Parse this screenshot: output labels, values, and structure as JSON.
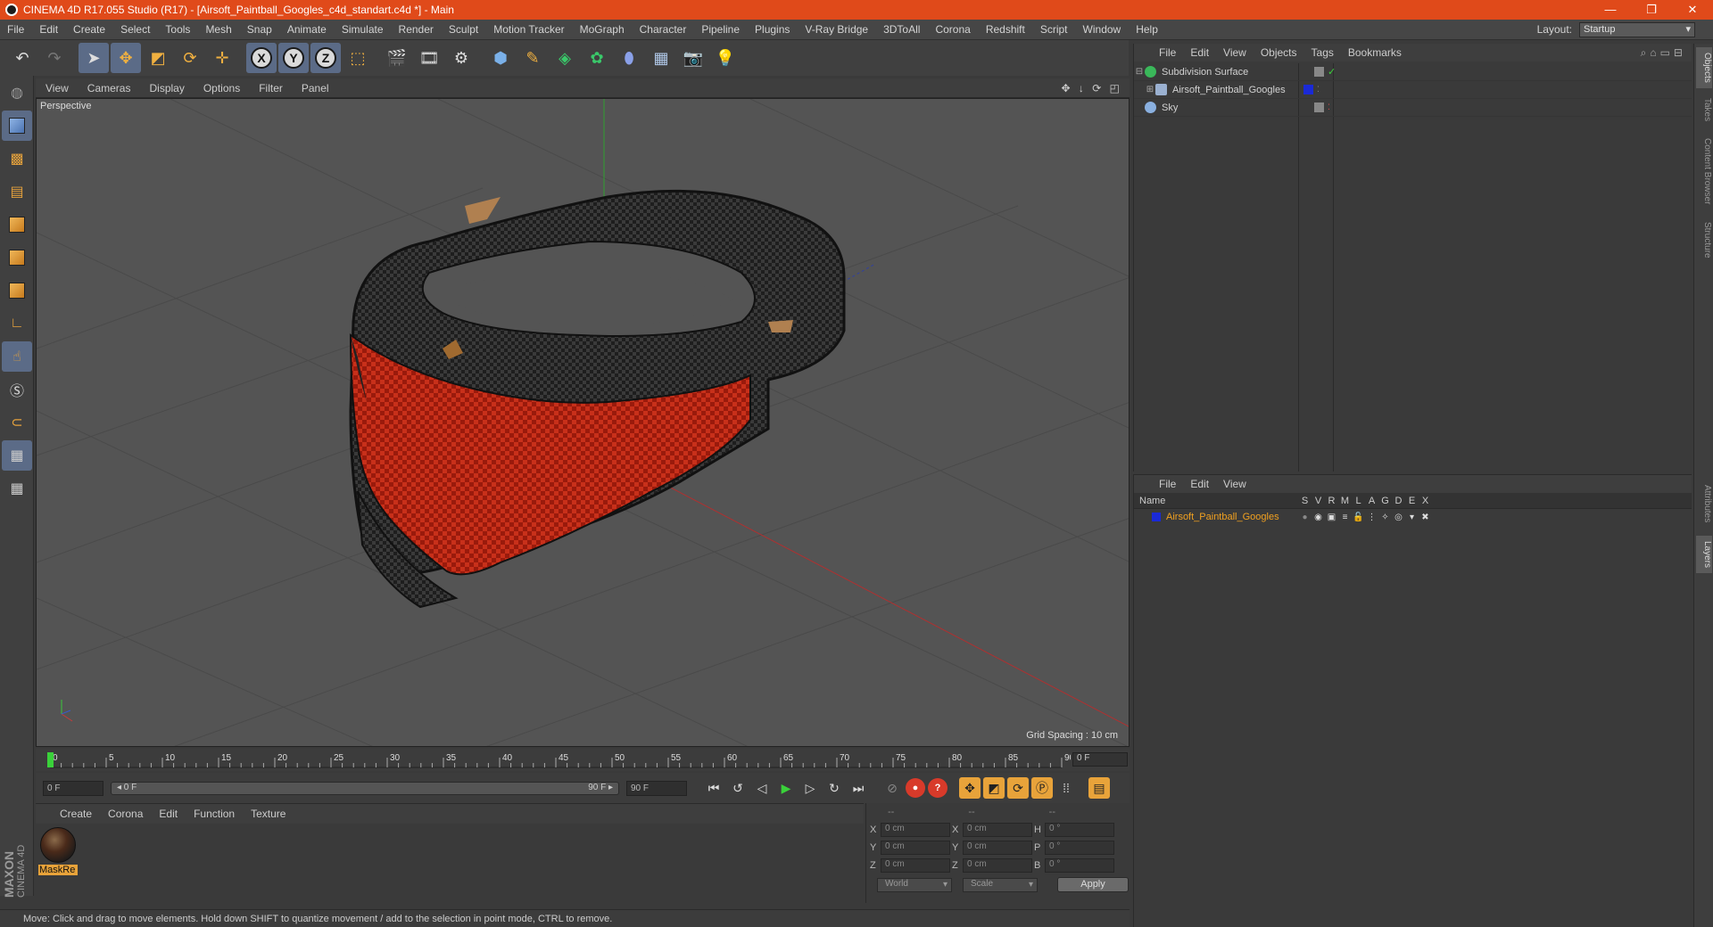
{
  "window": {
    "title": "CINEMA 4D R17.055 Studio (R17) - [Airsoft_Paintball_Googles_c4d_standart.c4d *] - Main",
    "buttons": [
      "—",
      "❐",
      "✕"
    ]
  },
  "menubar": {
    "items": [
      "File",
      "Edit",
      "Create",
      "Select",
      "Tools",
      "Mesh",
      "Snap",
      "Animate",
      "Simulate",
      "Render",
      "Sculpt",
      "Motion Tracker",
      "MoGraph",
      "Character",
      "Pipeline",
      "Plugins",
      "V-Ray Bridge",
      "3DToAll",
      "Corona",
      "Redshift",
      "Script",
      "Window",
      "Help"
    ],
    "layout_label": "Layout:",
    "layout_value": "Startup"
  },
  "toolbar": {
    "axis_x": "X",
    "axis_y": "Y",
    "axis_z": "Z"
  },
  "viewport": {
    "menu": [
      "View",
      "Cameras",
      "Display",
      "Options",
      "Filter",
      "Panel"
    ],
    "nav_icons": "✥ ↓ ⟳ ◰",
    "camera_label": "Perspective",
    "grid_spacing": "Grid Spacing : 10 cm",
    "colors": {
      "background": "#545454",
      "grid": "#4a4a4a",
      "x_axis": "#b03030",
      "y_axis": "#30a030",
      "checker_dark": "#2a2a2a",
      "checker_red": "#b02010"
    }
  },
  "timeline": {
    "ticks": [
      "0",
      "5",
      "10",
      "15",
      "20",
      "25",
      "30",
      "35",
      "40",
      "45",
      "50",
      "55",
      "60",
      "65",
      "70",
      "75",
      "80",
      "85",
      "90"
    ],
    "current_frame": "0 F"
  },
  "playbar": {
    "start_frame": "0 F",
    "range_start": "◂ 0 F",
    "range_end": "90 F ▸",
    "end_frame": "90 F"
  },
  "material_manager": {
    "menu": [
      "Create",
      "Corona",
      "Edit",
      "Function",
      "Texture"
    ],
    "materials": [
      {
        "name": "MaskRe"
      }
    ]
  },
  "coordinates": {
    "headers": [
      "--",
      "--",
      "--"
    ],
    "rows": [
      {
        "a1": "X",
        "v1": "0 cm",
        "a2": "X",
        "v2": "0 cm",
        "a3": "H",
        "v3": "0 °"
      },
      {
        "a1": "Y",
        "v1": "0 cm",
        "a2": "Y",
        "v2": "0 cm",
        "a3": "P",
        "v3": "0 °"
      },
      {
        "a1": "Z",
        "v1": "0 cm",
        "a2": "Z",
        "v2": "0 cm",
        "a3": "B",
        "v3": "0 °"
      }
    ],
    "mode": "World",
    "scale": "Scale",
    "apply": "Apply"
  },
  "brand": {
    "line1": "MAXON",
    "line2": "CINEMA 4D"
  },
  "status": "Move: Click and drag to move elements. Hold down SHIFT to quantize movement / add to the selection in point mode, CTRL to remove.",
  "object_manager": {
    "menu": [
      "File",
      "Edit",
      "View",
      "Objects",
      "Tags",
      "Bookmarks"
    ],
    "objects": [
      {
        "name": "Subdivision Surface",
        "icon_color": "#3ab85a"
      },
      {
        "name": "Airsoft_Paintball_Googles",
        "icon_color": "#9ab0d0"
      },
      {
        "name": "Sky",
        "icon_color": "#8ab0e0"
      }
    ]
  },
  "layer_manager": {
    "menu": [
      "File",
      "Edit",
      "View"
    ],
    "name_header": "Name",
    "columns": [
      "S",
      "V",
      "R",
      "M",
      "L",
      "A",
      "G",
      "D",
      "E",
      "X"
    ],
    "layers": [
      {
        "name": "Airsoft_Paintball_Googles",
        "color": "#1a2ad6"
      }
    ]
  },
  "side_tabs": [
    "Objects",
    "Takes",
    "Content Browser",
    "Structure",
    "Attributes",
    "Layers"
  ]
}
